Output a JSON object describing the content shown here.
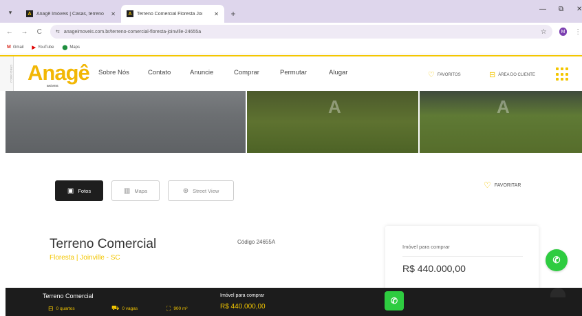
{
  "browser": {
    "tabs": [
      {
        "title": "Anagê Imóveis | Casas, terreno",
        "active": false
      },
      {
        "title": "Terreno Comercial Floresta Joi",
        "active": true
      }
    ],
    "new_tab_icon": "plus-icon",
    "controls": {
      "minimize": "—",
      "maximize": "⧉",
      "close": "✕"
    },
    "url": "anageimoveis.com.br/terreno-comercial-floresta-joinville-24655a",
    "profile_initial": "M",
    "bookmarks": [
      {
        "label": "Gmail",
        "icon": "M",
        "color": "#d93025"
      },
      {
        "label": "YouTube",
        "icon": "▶",
        "color": "#e00000"
      },
      {
        "label": "Maps",
        "icon": "⬤",
        "color": "#1e8e3e"
      }
    ]
  },
  "site": {
    "side_label": "CRECI 0000-J",
    "logo": {
      "text": "Anagê",
      "sub": "IMÓVEIS"
    },
    "menu": [
      "Sobre Nós",
      "Contato",
      "Anuncie",
      "Comprar",
      "Permutar",
      "Alugar"
    ],
    "favorites_label": "FAVORITOS",
    "client_area_label": "ÁREA DO CLIENTE",
    "accent": "#f3c600"
  },
  "gallery": {
    "watermark": "A"
  },
  "media_tabs": [
    {
      "label": "Fotos",
      "icon": "photo-icon",
      "active": true
    },
    {
      "label": "Mapa",
      "icon": "map-icon",
      "active": false
    },
    {
      "label": "Street View",
      "icon": "street-view-icon",
      "active": false
    }
  ],
  "favoritar_label": "FAVORITAR",
  "property": {
    "title": "Terreno Comercial",
    "location": "Floresta | Joinville - SC",
    "code_label": "Código 24655A",
    "price_label": "Imóvel para comprar",
    "price": "R$ 440.000,00"
  },
  "bottom_bar": {
    "title": "Terreno Comercial",
    "features": [
      {
        "icon": "bed-icon",
        "label": "0 quartos"
      },
      {
        "icon": "car-icon",
        "label": "0 vagas"
      },
      {
        "icon": "area-icon",
        "label": "900 m²"
      }
    ],
    "buy_label": "Imóvel para comprar",
    "buy_value": "R$ 440.000,00"
  }
}
